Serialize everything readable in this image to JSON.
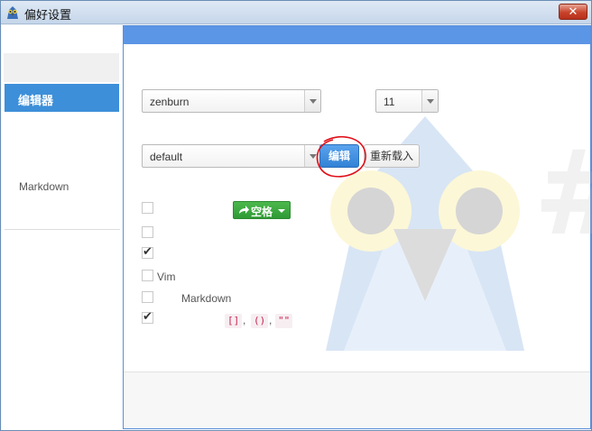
{
  "window": {
    "title": "偏好设置",
    "close_symbol": "✕",
    "icon": "app-mascot-icon"
  },
  "sidebar": {
    "items": [
      {
        "label": "编辑器",
        "selected": true
      },
      {
        "label": "Markdown",
        "selected": false
      }
    ]
  },
  "editor": {
    "theme_select": {
      "value": "zenburn"
    },
    "font_size_select": {
      "value": "11"
    },
    "keymap_select": {
      "value": "default"
    },
    "edit_button": "编辑",
    "reload_button": "重新载入",
    "space_button": "空格",
    "options": [
      {
        "checked": false,
        "label": ""
      },
      {
        "checked": false,
        "label": ""
      },
      {
        "checked": true,
        "label": ""
      },
      {
        "checked": false,
        "label": "Vim"
      },
      {
        "checked": false,
        "label": "Markdown"
      },
      {
        "checked": true,
        "label": ""
      }
    ],
    "brackets": {
      "tags": [
        "[]",
        "()",
        "\"\""
      ],
      "separator": ","
    }
  },
  "colors": {
    "accent": "#3d8fd9",
    "panel_header": "#5b95e6",
    "success": "#2f9a35",
    "annotation": "#e0101a"
  }
}
